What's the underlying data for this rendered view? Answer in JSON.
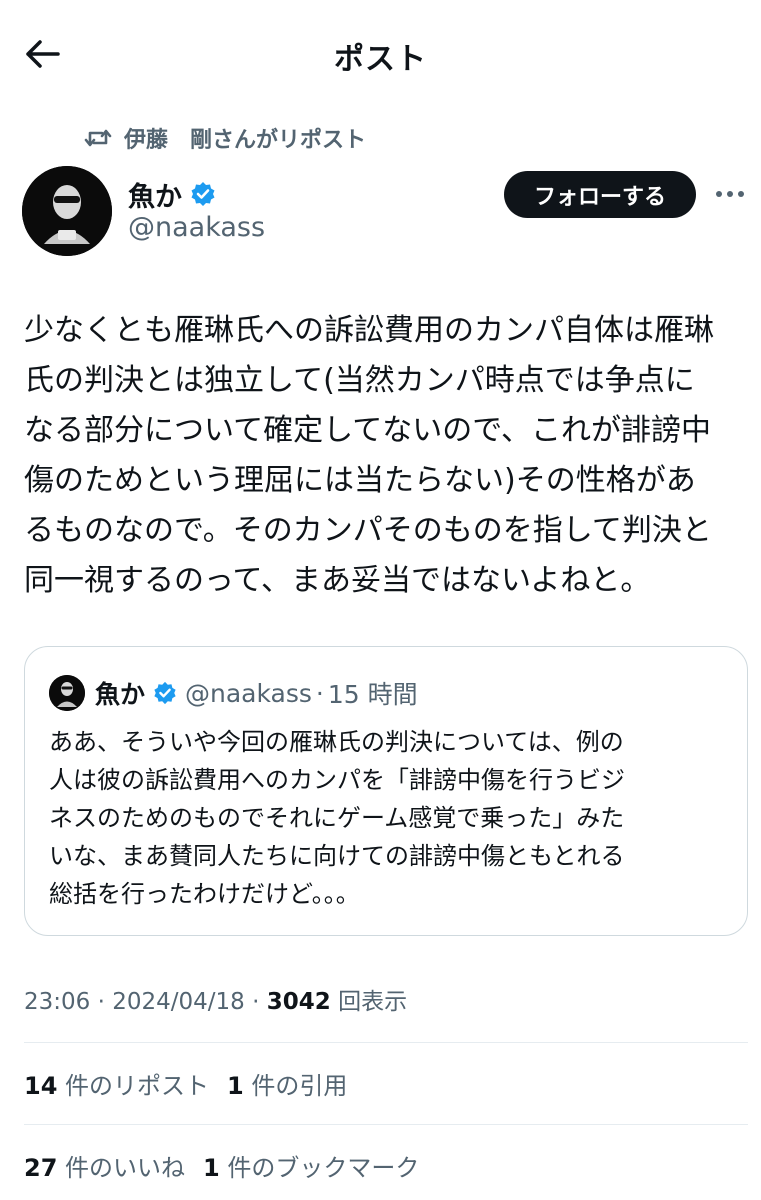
{
  "header": {
    "title": "ポスト"
  },
  "repost": {
    "text": "伊藤　剛さんがリポスト"
  },
  "author": {
    "name": "魚か",
    "handle": "@naakass"
  },
  "follow_button": {
    "label": "フォローする"
  },
  "tweet": {
    "lines": [
      "少なくとも雁琳氏への訴訟費用のカンパ自体は雁琳",
      "氏の判決とは独立して(当然カンパ時点では争点に",
      "なる部分について確定してないので、これが誹謗中",
      "傷のためという理屈には当たらない)その性格があ",
      "るものなので。そのカンパそのものを指して判決と",
      "同一視するのって、まあ妥当ではないよねと。"
    ]
  },
  "quote": {
    "name": "魚か",
    "handle": "@naakass",
    "separator": "·",
    "time": "15 時間",
    "lines": [
      "ああ、そういや今回の雁琳氏の判決については、例の",
      "人は彼の訴訟費用へのカンパを「誹謗中傷を行うビジ",
      "ネスのためのものでそれにゲーム感覚で乗った」みた",
      "いな、まあ賛同人たちに向けての誹謗中傷ともとれる",
      "総括を行ったわけだけど。。。"
    ]
  },
  "meta": {
    "time": "23:06",
    "sep1": " · ",
    "date": "2024/04/18",
    "sep2": " · ",
    "views": "3042",
    "views_label": " 回表示"
  },
  "stats": {
    "reposts_count": "14",
    "reposts_label": " 件のリポスト",
    "quotes_count": "1",
    "quotes_label": " 件の引用",
    "likes_count": "27",
    "likes_label": " 件のいいね",
    "bookmarks_count": "1",
    "bookmarks_label": " 件のブックマーク"
  },
  "colors": {
    "text": "#0f1419",
    "secondary": "#536471",
    "verified": "#1d9bf0",
    "border": "#cfd9de"
  },
  "icons": {
    "back": "arrow-left-icon",
    "repost": "repost-icon",
    "verified": "verified-badge-icon",
    "more": "more-horizontal-icon"
  }
}
